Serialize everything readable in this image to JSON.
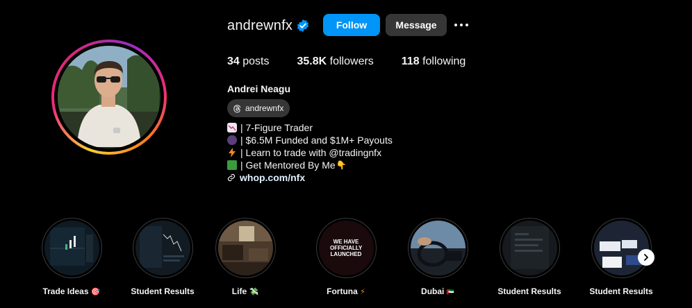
{
  "profile": {
    "username": "andrewnfx",
    "full_name": "Andrei Neagu",
    "verified_icon": "verified-badge-icon",
    "follow_label": "Follow",
    "message_label": "Message",
    "threads_handle": "andrewnfx"
  },
  "stats": {
    "posts_count": "34",
    "posts_label": "posts",
    "followers_count": "35.8K",
    "followers_label": "followers",
    "following_count": "118",
    "following_label": "following"
  },
  "bio": {
    "line1": "| 7-Figure Trader",
    "line2": "| $6.5M Funded and $1M+ Payouts",
    "line3": "| Learn to trade with @tradingnfx",
    "line4": "| Get Mentored By Me",
    "line4_suffix": "👇",
    "link": "whop.com/nfx"
  },
  "highlights": [
    {
      "label": "Trade Ideas",
      "suffix": "🎯"
    },
    {
      "label": "Student Results",
      "suffix": ""
    },
    {
      "label": "Life",
      "suffix": "💸"
    },
    {
      "label": "Fortuna",
      "suffix": "⚡"
    },
    {
      "label": "Dubai",
      "suffix": "🇦🇪"
    },
    {
      "label": "Student Results",
      "suffix": ""
    },
    {
      "label": "Student Results",
      "suffix": ""
    }
  ],
  "fortuna_cover_text": "WE HAVE OFFICIALLY LAUNCHED",
  "colors": {
    "follow_button": "#0095f6",
    "message_button": "#363636",
    "background": "#000000",
    "link": "#e0f1ff"
  }
}
